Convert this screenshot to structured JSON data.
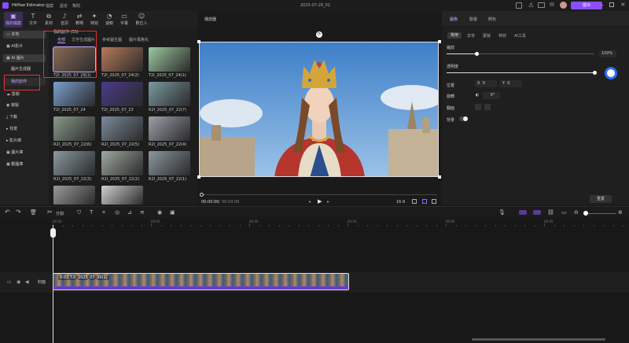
{
  "app": {
    "name": "HitPaw Edimakor",
    "menus": [
      "檔案",
      "設定",
      "幫助"
    ],
    "date_title": "2025-07-29_02",
    "export_label": "匯出"
  },
  "toolbar": {
    "items": [
      {
        "label": "我的檔案",
        "icon": "folder-icon"
      },
      {
        "label": "文字",
        "icon": "text-icon"
      },
      {
        "label": "素材",
        "icon": "sticker-icon"
      },
      {
        "label": "音訊",
        "icon": "music-icon"
      },
      {
        "label": "轉場",
        "icon": "transition-icon"
      },
      {
        "label": "特效",
        "icon": "sparkle-icon"
      },
      {
        "label": "濾鏡",
        "icon": "filter-icon"
      },
      {
        "label": "字幕",
        "icon": "subtitle-icon"
      },
      {
        "label": "數位人",
        "icon": "avatar-icon"
      }
    ]
  },
  "sidebar": {
    "items": [
      {
        "label": "本地",
        "icon": "folder-icon"
      },
      {
        "label": "AI影片",
        "icon": "ai-video-icon"
      },
      {
        "label": "AI 圖片",
        "icon": "ai-image-icon"
      },
      {
        "label": "圖片生成器",
        "icon": ""
      },
      {
        "label": "我的創作",
        "icon": ""
      },
      {
        "label": "雲端",
        "icon": "cloud-icon"
      },
      {
        "label": "錄製",
        "icon": "record-icon"
      },
      {
        "label": "下載",
        "icon": "download-icon"
      },
      {
        "label": "背景",
        "icon": "background-icon"
      },
      {
        "label": "影片庫",
        "icon": "video-library-icon"
      },
      {
        "label": "圖片庫",
        "icon": "image-library-icon"
      },
      {
        "label": "動圖庫",
        "icon": "gif-library-icon"
      }
    ]
  },
  "media": {
    "heading": "我的創作 (55)",
    "tabs": [
      "全部",
      "文字生成圖片",
      "參考圖生圖",
      "圖片風格化"
    ],
    "items": [
      {
        "label": "T2I_2025_07_29(1)",
        "color": "#8a6a5a"
      },
      {
        "label": "T2I_2025_07_24(2)",
        "color": "#b87a5a"
      },
      {
        "label": "T2I_2025_07_24(1)",
        "color": "#9cc8a0"
      },
      {
        "label": "T2I_2025_07_24",
        "color": "#7aa0d0"
      },
      {
        "label": "T2I_2025_07_23",
        "color": "#4a3a8a"
      },
      {
        "label": "R2I_2025_07_22(7)",
        "color": "#7a9aa0"
      },
      {
        "label": "R2I_2025_07_22(6)",
        "color": "#8a9a8a"
      },
      {
        "label": "R2I_2025_07_22(5)",
        "color": "#7a8a9a"
      },
      {
        "label": "R2I_2025_07_22(4)",
        "color": "#9aa0a8"
      },
      {
        "label": "R2I_2025_07_22(3)",
        "color": "#8a9aa0"
      },
      {
        "label": "R2I_2025_07_22(2)",
        "color": "#a0a8a0"
      },
      {
        "label": "R2I_2025_07_22(1)",
        "color": "#8a98a0"
      },
      {
        "label": "",
        "color": "#9a9a9a"
      },
      {
        "label": "",
        "color": "#d0d0d0"
      }
    ]
  },
  "preview": {
    "title": "播放器",
    "time_current": "00:00:00",
    "time_total": "00:03:00",
    "aspect": "16:9"
  },
  "props": {
    "tabs": [
      "圖像",
      "動畫",
      "顏色"
    ],
    "subtabs": [
      "常用",
      "去背",
      "蒙版",
      "特效",
      "AI工具"
    ],
    "scale_label": "縮放",
    "scale_value": "100%",
    "opacity_label": "透明度",
    "position_label": "位置",
    "pos_x_label": "X",
    "pos_x": "0",
    "pos_y_label": "Y",
    "pos_y": "0",
    "rotate_label": "旋轉",
    "rotate_value": "0°",
    "flip_label": "翻面",
    "background_label": "背景",
    "reset_label": "重置"
  },
  "timeline_toolbar": {
    "split_label": "分割"
  },
  "timeline": {
    "ruler": [
      "00:00",
      "00:01",
      "00:02",
      "00:03",
      "00:04",
      "00:05",
      "00:06"
    ],
    "cover_label": "封面",
    "clip_label": "0:03 T2I_2025_07_29(1)"
  }
}
